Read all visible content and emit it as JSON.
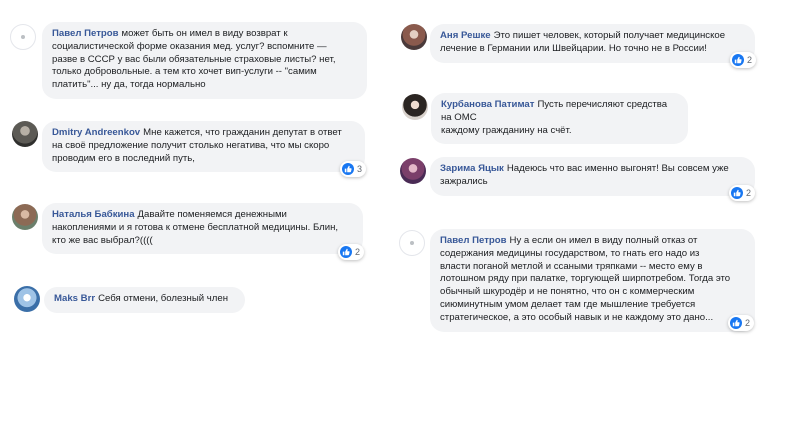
{
  "colors": {
    "bubble_bg": "#f2f3f5",
    "author_link": "#385898",
    "like_blue": "#1877f2"
  },
  "left_comments": [
    {
      "author": "Павел Петров",
      "lines": [
        "может быть он имел в виду возврат к",
        "социалистической форме оказания мед. услуг? вспомните —",
        "разве в СССР у вас были обязательные страховые листы? нет,",
        "только добровольные. а тем кто хочет вип-услуги -- \"самим",
        "платить\"... ну да, тогда нормально"
      ],
      "reactions": ""
    },
    {
      "author": "Dmitry Andreenkov",
      "lines": [
        "Мне кажется, что гражданин депутат в ответ",
        "на своё предложение получит столько негатива, что мы скоро",
        "проводим его в последний путь,"
      ],
      "reactions": "3"
    },
    {
      "author": "Наталья Бабкина",
      "lines": [
        "Давайте поменяемся денежными",
        "накоплениями и я готова к отмене бесплатной медицины. Блин,",
        "кто же вас выбрал?(((("
      ],
      "reactions": "2"
    },
    {
      "author": "Maks Brr",
      "lines": [
        "Себя отмени, болезный член"
      ],
      "reactions": ""
    }
  ],
  "right_comments": [
    {
      "author": "Аня Решке",
      "lines": [
        "Это пишет человек, который получает медицинское",
        "лечение в Германии или Швейцарии. Но точно не в России!"
      ],
      "reactions": "2"
    },
    {
      "author": "Курбанова Патимат",
      "lines": [
        "Пусть перечисляют средства на ОМС",
        "каждому гражданину на счёт."
      ],
      "reactions": ""
    },
    {
      "author": "Зарима Яцык",
      "lines": [
        "Надеюсь что вас именно выгонят! Вы совсем уже",
        "зажрались"
      ],
      "reactions": "2"
    },
    {
      "author": "Павел Петров",
      "lines": [
        "Ну а если он имел в виду полный отказ от",
        "содержания медицины государством, то гнать его надо из",
        "власти поганой метлой и ссаными тряпками -- место ему в",
        "лотошном ряду при палатке, торгующей ширпотребом. Тогда это",
        "обычный шкуродёр и не понятно, что он с коммерческим",
        "сиюминутным умом делает там где мышление требуется",
        "стратегическое, а это особый навык и не каждому это дано..."
      ],
      "reactions": "2"
    }
  ]
}
